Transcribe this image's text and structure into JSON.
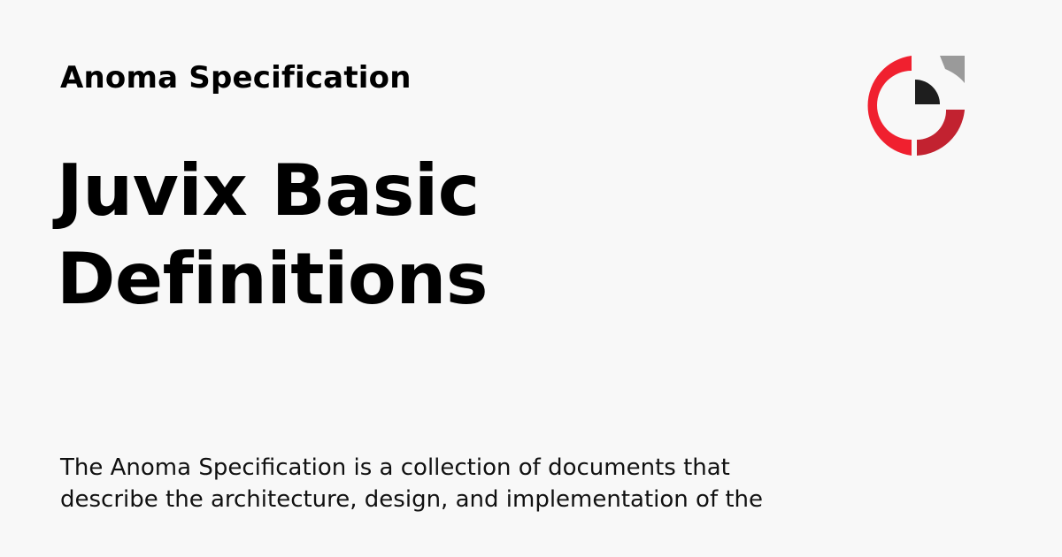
{
  "site": {
    "name": "Anoma Specification"
  },
  "page": {
    "title_lines": [
      "Juvix Basic",
      "Definitions"
    ],
    "description_lines": [
      "The Anoma Specification is a collection of documents that",
      "describe the architecture, design, and implementation of the"
    ]
  },
  "logo": {
    "icon": "anoma-logo-icon",
    "colors": {
      "red_light": "#f0202f",
      "red_dark": "#c22230",
      "center_dark": "#1e1e1e",
      "corner_gray": "#9a9a9a"
    }
  }
}
